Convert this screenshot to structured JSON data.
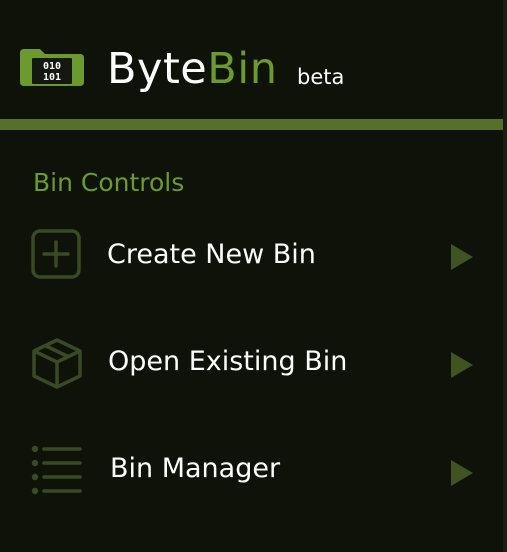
{
  "header": {
    "logo_icon": "binary-folder-icon",
    "logo_bits_top": "010",
    "logo_bits_bottom": "101",
    "brand_part1": "Byte",
    "brand_part2": "Bin",
    "badge": "beta"
  },
  "bin_controls": {
    "title": "Bin Controls",
    "items": [
      {
        "label": "Create New Bin",
        "icon": "plus-square-icon",
        "arrow_icon": "play-arrow-icon"
      },
      {
        "label": "Open Existing Bin",
        "icon": "box-icon",
        "arrow_icon": "play-arrow-icon"
      },
      {
        "label": "Bin Manager",
        "icon": "list-icon",
        "arrow_icon": "play-arrow-icon"
      }
    ]
  },
  "colors": {
    "background": "#0f1209",
    "accent": "#6b9a2e",
    "divider": "#56702c",
    "icon_muted": "#3a4a22",
    "arrow": "#3f5323",
    "text": "#ffffff"
  }
}
